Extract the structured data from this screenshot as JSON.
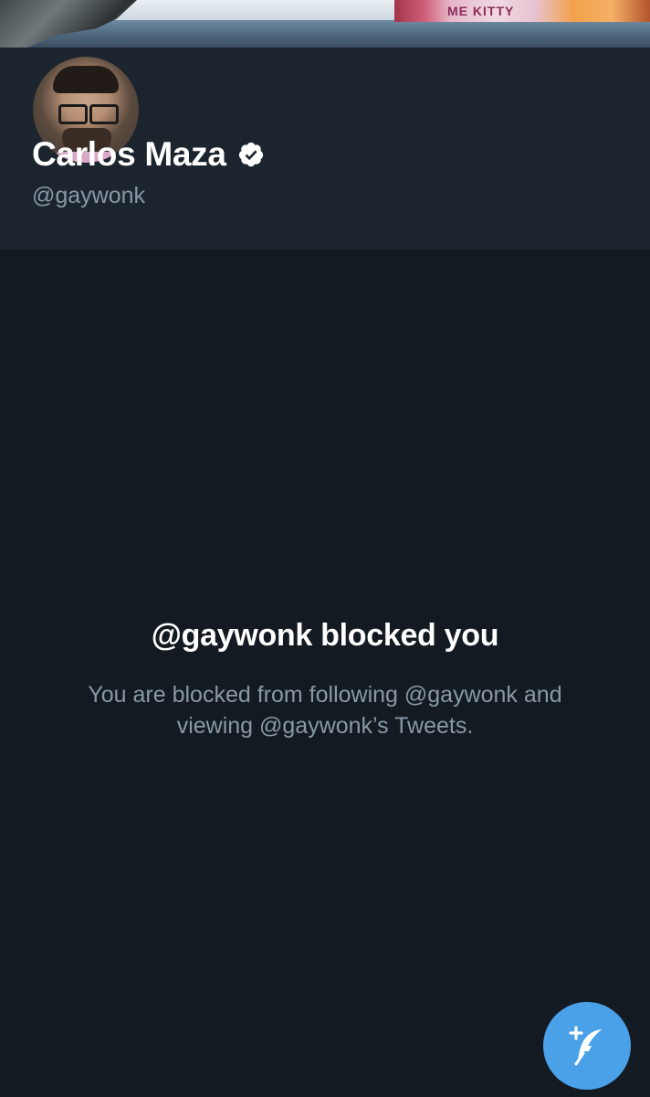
{
  "banner": {
    "photo_text": "ME KITTY"
  },
  "profile": {
    "display_name": "Carlos Maza",
    "handle": "@gaywonk",
    "verified": true,
    "verified_icon": "verified-badge-icon"
  },
  "blocked": {
    "title": "@gaywonk blocked you",
    "line1": "You are blocked from following @gaywonk and",
    "line2": "viewing @gaywonk’s Tweets."
  },
  "compose": {
    "icon": "compose-tweet-icon",
    "color": "#4aa1e8"
  },
  "colors": {
    "background": "#141a21",
    "card": "#1c242d",
    "text_primary": "#ffffff",
    "text_secondary": "#8899a6"
  }
}
